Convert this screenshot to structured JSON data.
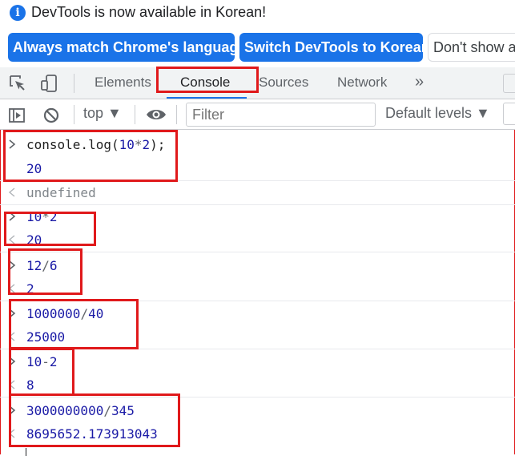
{
  "infobar": {
    "message": "DevTools is now available in Korean!",
    "buttons": [
      {
        "label": "Always match Chrome's language"
      },
      {
        "label": "Switch DevTools to Korean"
      },
      {
        "label": "Don't show a"
      }
    ]
  },
  "tabs": [
    {
      "label": "Elements"
    },
    {
      "label": "Console"
    },
    {
      "label": "Sources"
    },
    {
      "label": "Network"
    }
  ],
  "tabs_more": "»",
  "toolbar": {
    "context": "top ▼",
    "filter_placeholder": "Filter",
    "levels": "Default levels ▼"
  },
  "console": {
    "entries": [
      {
        "type": "input",
        "parts": [
          "console.log(",
          "10",
          "*",
          "2",
          ");"
        ]
      },
      {
        "type": "log",
        "text": "20"
      },
      {
        "type": "result",
        "text": "undefined"
      },
      {
        "type": "input",
        "parts": [
          "10",
          "*",
          "2"
        ]
      },
      {
        "type": "result",
        "text": "20"
      },
      {
        "type": "input",
        "parts": [
          "12",
          "/",
          "6"
        ]
      },
      {
        "type": "result",
        "text": "2"
      },
      {
        "type": "input",
        "parts": [
          "1000000",
          "/",
          "40"
        ]
      },
      {
        "type": "result",
        "text": "25000"
      },
      {
        "type": "input",
        "parts": [
          "10",
          "-",
          "2"
        ]
      },
      {
        "type": "result",
        "text": "8"
      },
      {
        "type": "input",
        "parts": [
          "3000000000",
          "/",
          "345"
        ]
      },
      {
        "type": "result",
        "text": "8695652.173913043"
      }
    ]
  },
  "colors": {
    "accent": "#1a73e8",
    "highlight": "#e0191b",
    "number": "#1a1aa6"
  }
}
